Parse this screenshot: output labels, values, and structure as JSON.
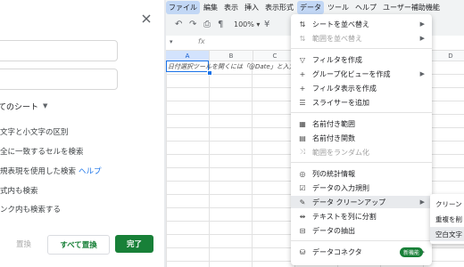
{
  "dialog": {
    "sheet_scope": "てのシート",
    "options": [
      "文字と小文字の区別",
      "全に一致するセルを検索",
      "規表現を使用した検索",
      "式内も検索",
      "ンク内も検索する"
    ],
    "help_link": "ヘルプ",
    "replace_button": "置換",
    "replace_all_button": "すべて置換",
    "done_button": "完了"
  },
  "menubar": [
    "ファイル",
    "編集",
    "表示",
    "挿入",
    "表示形式",
    "データ",
    "ツール",
    "ヘルプ",
    "ユーザー補助機能"
  ],
  "toolbar": {
    "zoom": "100%",
    "fx": "fx"
  },
  "grid": {
    "columns": [
      "A",
      "B",
      "C",
      "D"
    ],
    "a1_text": "日付選択ツールを開くには「@Date」と入力します"
  },
  "data_menu": {
    "items": [
      {
        "label": "シートを並べ替え",
        "icon": "sort-icon",
        "arrow": true,
        "disabled": false
      },
      {
        "label": "範囲を並べ替え",
        "icon": "sort-range-icon",
        "arrow": true,
        "disabled": true
      },
      {
        "label": "フィルタを作成",
        "icon": "filter-icon",
        "arrow": false,
        "disabled": false
      },
      {
        "label": "グループ化ビューを作成",
        "icon": "group-view-icon",
        "arrow": true,
        "disabled": false
      },
      {
        "label": "フィルタ表示を作成",
        "icon": "filter-view-icon",
        "arrow": false,
        "disabled": false
      },
      {
        "label": "スライサーを追加",
        "icon": "slicer-icon",
        "arrow": false,
        "disabled": false
      },
      {
        "label": "名前付き範囲",
        "icon": "named-range-icon",
        "arrow": false,
        "disabled": false
      },
      {
        "label": "名前付き関数",
        "icon": "named-function-icon",
        "arrow": false,
        "disabled": false
      },
      {
        "label": "範囲をランダム化",
        "icon": "randomize-icon",
        "arrow": false,
        "disabled": true
      },
      {
        "label": "列の統計情報",
        "icon": "column-stats-icon",
        "arrow": false,
        "disabled": false
      },
      {
        "label": "データの入力規則",
        "icon": "data-validation-icon",
        "arrow": false,
        "disabled": false
      },
      {
        "label": "データ クリーンアップ",
        "icon": "cleanup-icon",
        "arrow": true,
        "disabled": false
      },
      {
        "label": "テキストを列に分割",
        "icon": "split-text-icon",
        "arrow": false,
        "disabled": false
      },
      {
        "label": "データの抽出",
        "icon": "extract-icon",
        "arrow": false,
        "disabled": false
      },
      {
        "label": "データコネクタ",
        "icon": "data-connector-icon",
        "arrow": true,
        "disabled": false
      }
    ],
    "new_badge": "新機能"
  },
  "submenu": {
    "items": [
      "クリーン",
      "重複を削",
      "空白文字"
    ]
  }
}
